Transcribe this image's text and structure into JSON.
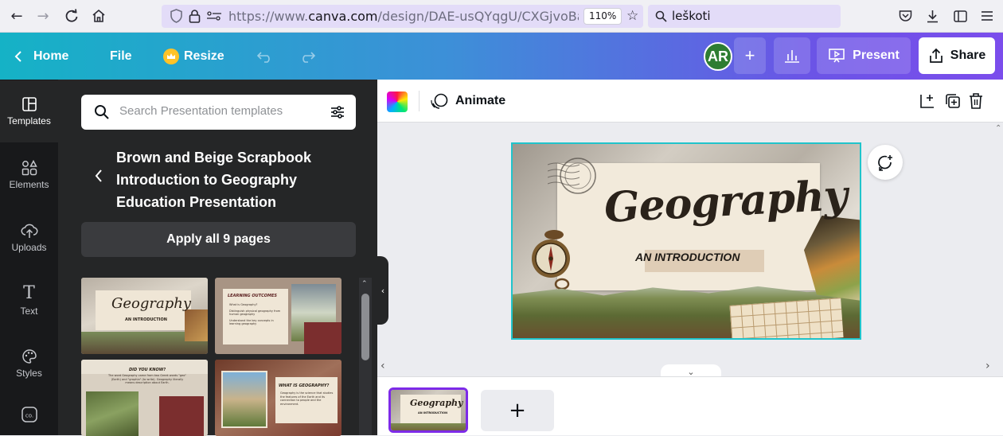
{
  "browser": {
    "url_prefix": "https://www.",
    "url_host": "canva.com",
    "url_path": "/design/DAE-usQYqgU/CXGjvoBafr",
    "zoom": "110%",
    "search_text": "leškoti"
  },
  "header": {
    "home_label": "Home",
    "file_label": "File",
    "resize_label": "Resize",
    "avatar_initials": "AR",
    "present_label": "Present",
    "share_label": "Share",
    "gradient_start": "#15b2c6",
    "gradient_end": "#7b4dec"
  },
  "rail": {
    "items": [
      {
        "label": "Templates",
        "icon": "templates-icon"
      },
      {
        "label": "Elements",
        "icon": "elements-icon"
      },
      {
        "label": "Uploads",
        "icon": "uploads-icon"
      },
      {
        "label": "Text",
        "icon": "text-icon"
      },
      {
        "label": "Styles",
        "icon": "styles-icon"
      },
      {
        "label": "",
        "icon": "brand-icon"
      }
    ]
  },
  "panel": {
    "search_placeholder": "Search Presentation templates",
    "template_title": "Brown and Beige Scrapbook Introduction to Geography Education Presentation",
    "apply_label": "Apply all 9 pages",
    "thumbnails": [
      {
        "title": "Geography",
        "subtitle": "AN INTRODUCTION"
      },
      {
        "title": "LEARNING OUTCOMES",
        "bullets": [
          "What is Geography?",
          "Distinguish physical geography from human geography",
          "Understand the key concepts in learning geography"
        ]
      },
      {
        "title": "DID YOU KNOW?",
        "body": "The word Geography came from two Greek words \"geo\" (Earth) and \"graphia\" (to write). Geography literally means description about Earth."
      },
      {
        "title": "WHAT IS GEOGRAPHY?",
        "body": "Geography is the science that studies the features of the Earth and its connection to people and the environment."
      }
    ]
  },
  "toolbar": {
    "animate_label": "Animate"
  },
  "slide": {
    "title": "Geography",
    "subtitle": "AN INTRODUCTION",
    "accent_border": "#20c4cb"
  },
  "strip": {
    "thumb_title": "Geography",
    "thumb_subtitle": "AN INTRODUCTION",
    "add_label": "+",
    "active_border": "#7d2ae8"
  }
}
